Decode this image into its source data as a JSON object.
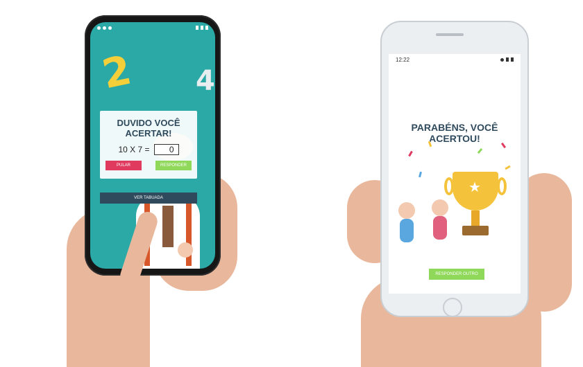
{
  "left_phone": {
    "quiz": {
      "title": "DUVIDO VOCÊ ACERTAR!",
      "equation": "10 X 7 =",
      "answer_value": "0",
      "skip_label": "PULAR",
      "answer_label": "RESPONDER",
      "table_label": "VER TABUADA"
    },
    "decor_numbers": [
      "2",
      "4"
    ],
    "colors": {
      "background": "#2aa9a7",
      "skip": "#e03a5f",
      "answer": "#8fd85a",
      "table": "#2f4a5c"
    }
  },
  "right_phone": {
    "status_time": "12:22",
    "title": "PARABÉNS, VOCÊ ACERTOU!",
    "button_label": "RESPONDER OUTRO",
    "icons": [
      "trophy-icon",
      "star-icon"
    ],
    "colors": {
      "title": "#2f4a5c",
      "button": "#8fd85a",
      "trophy": "#f5c33b"
    }
  }
}
